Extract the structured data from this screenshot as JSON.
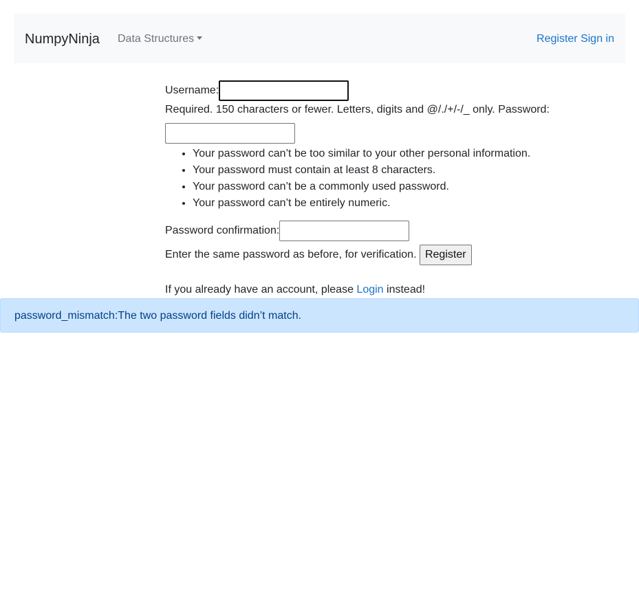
{
  "navbar": {
    "brand": "NumpyNinja",
    "dropdown_label": "Data Structures",
    "register_link": "Register",
    "signin_link": "Sign in"
  },
  "form": {
    "username_label": "Username:",
    "username_value": "",
    "username_help": "Required. 150 characters or fewer. Letters, digits and @/./+/-/_ only.",
    "password_label": "Password:",
    "password_value": "",
    "password_rules": [
      "Your password can’t be too similar to your other personal information.",
      "Your password must contain at least 8 characters.",
      "Your password can’t be a commonly used password.",
      "Your password can’t be entirely numeric."
    ],
    "confirm_label": "Password confirmation:",
    "confirm_value": "",
    "confirm_help": "Enter the same password as before, for verification.",
    "register_button": "Register"
  },
  "login_prompt": {
    "before": "If you already have an account, please",
    "link": "Login",
    "after": "instead!"
  },
  "alert": {
    "message": "password_mismatch:The two password fields didn’t match."
  }
}
